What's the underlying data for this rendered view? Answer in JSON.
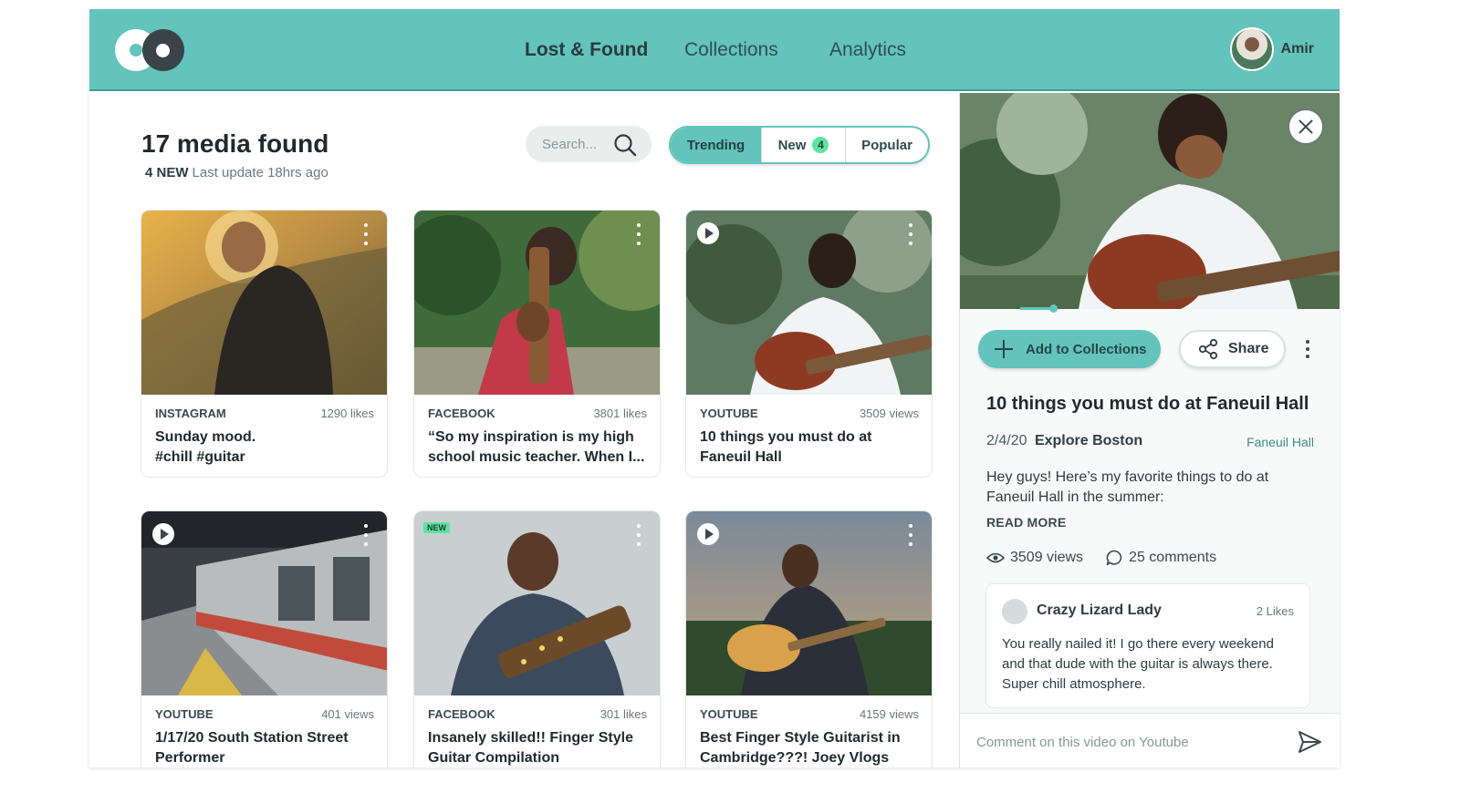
{
  "header": {
    "nav": [
      "Lost & Found",
      "Collections",
      "Analytics"
    ],
    "user_name": "Amir"
  },
  "main": {
    "title": "17 media found",
    "new_count_label": "4 NEW",
    "last_update": "Last update 18hrs ago",
    "search_placeholder": "Search...",
    "filters": {
      "trending": "Trending",
      "new": "New",
      "new_badge": "4",
      "popular": "Popular"
    },
    "cards": [
      {
        "source": "INSTAGRAM",
        "metric": "1290 likes",
        "title": "Sunday mood.\n#chill #guitar"
      },
      {
        "source": "FACEBOOK",
        "metric": "3801 likes",
        "title": "“So my inspiration is my high school music teacher. When I..."
      },
      {
        "source": "YOUTUBE",
        "metric": "3509 views",
        "title": "10 things you must do at Faneuil Hall"
      },
      {
        "source": "YOUTUBE",
        "metric": "401 views",
        "title": "1/17/20 South Station Street Performer"
      },
      {
        "source": "FACEBOOK",
        "metric": "301 likes",
        "title": "Insanely skilled!! Finger Style Guitar Compilation",
        "tag": "NEW"
      },
      {
        "source": "YOUTUBE",
        "metric": "4159 views",
        "title": "Best Finger Style Guitarist in Cambridge???! Joey Vlogs"
      }
    ]
  },
  "panel": {
    "add_label": "Add to Collections",
    "share_label": "Share",
    "title": "10 things you must do at Faneuil Hall",
    "date": "2/4/20",
    "author": "Explore Boston",
    "location": "Faneuil Hall",
    "description": "Hey guys! Here’s my favorite things to do at Faneuil Hall in the summer:",
    "read_more": "READ MORE",
    "views": "3509 views",
    "comments": "25 comments",
    "comment": {
      "author": "Crazy Lizard Lady",
      "likes": "2 Likes",
      "text": "You really nailed it! I go there every weekend and that dude with the guitar is always there. Super chill atmosphere."
    },
    "composer_placeholder": "Comment on this video on Youtube"
  },
  "icons": [
    "logo-icon",
    "search-icon",
    "more-vertical-icon",
    "play-icon",
    "close-icon",
    "plus-icon",
    "share-icon",
    "eye-icon",
    "comment-icon",
    "send-icon"
  ],
  "colors": {
    "brand_teal": "#63c3bd",
    "new_green": "#5ee3a0",
    "dark": "#3a4448"
  }
}
